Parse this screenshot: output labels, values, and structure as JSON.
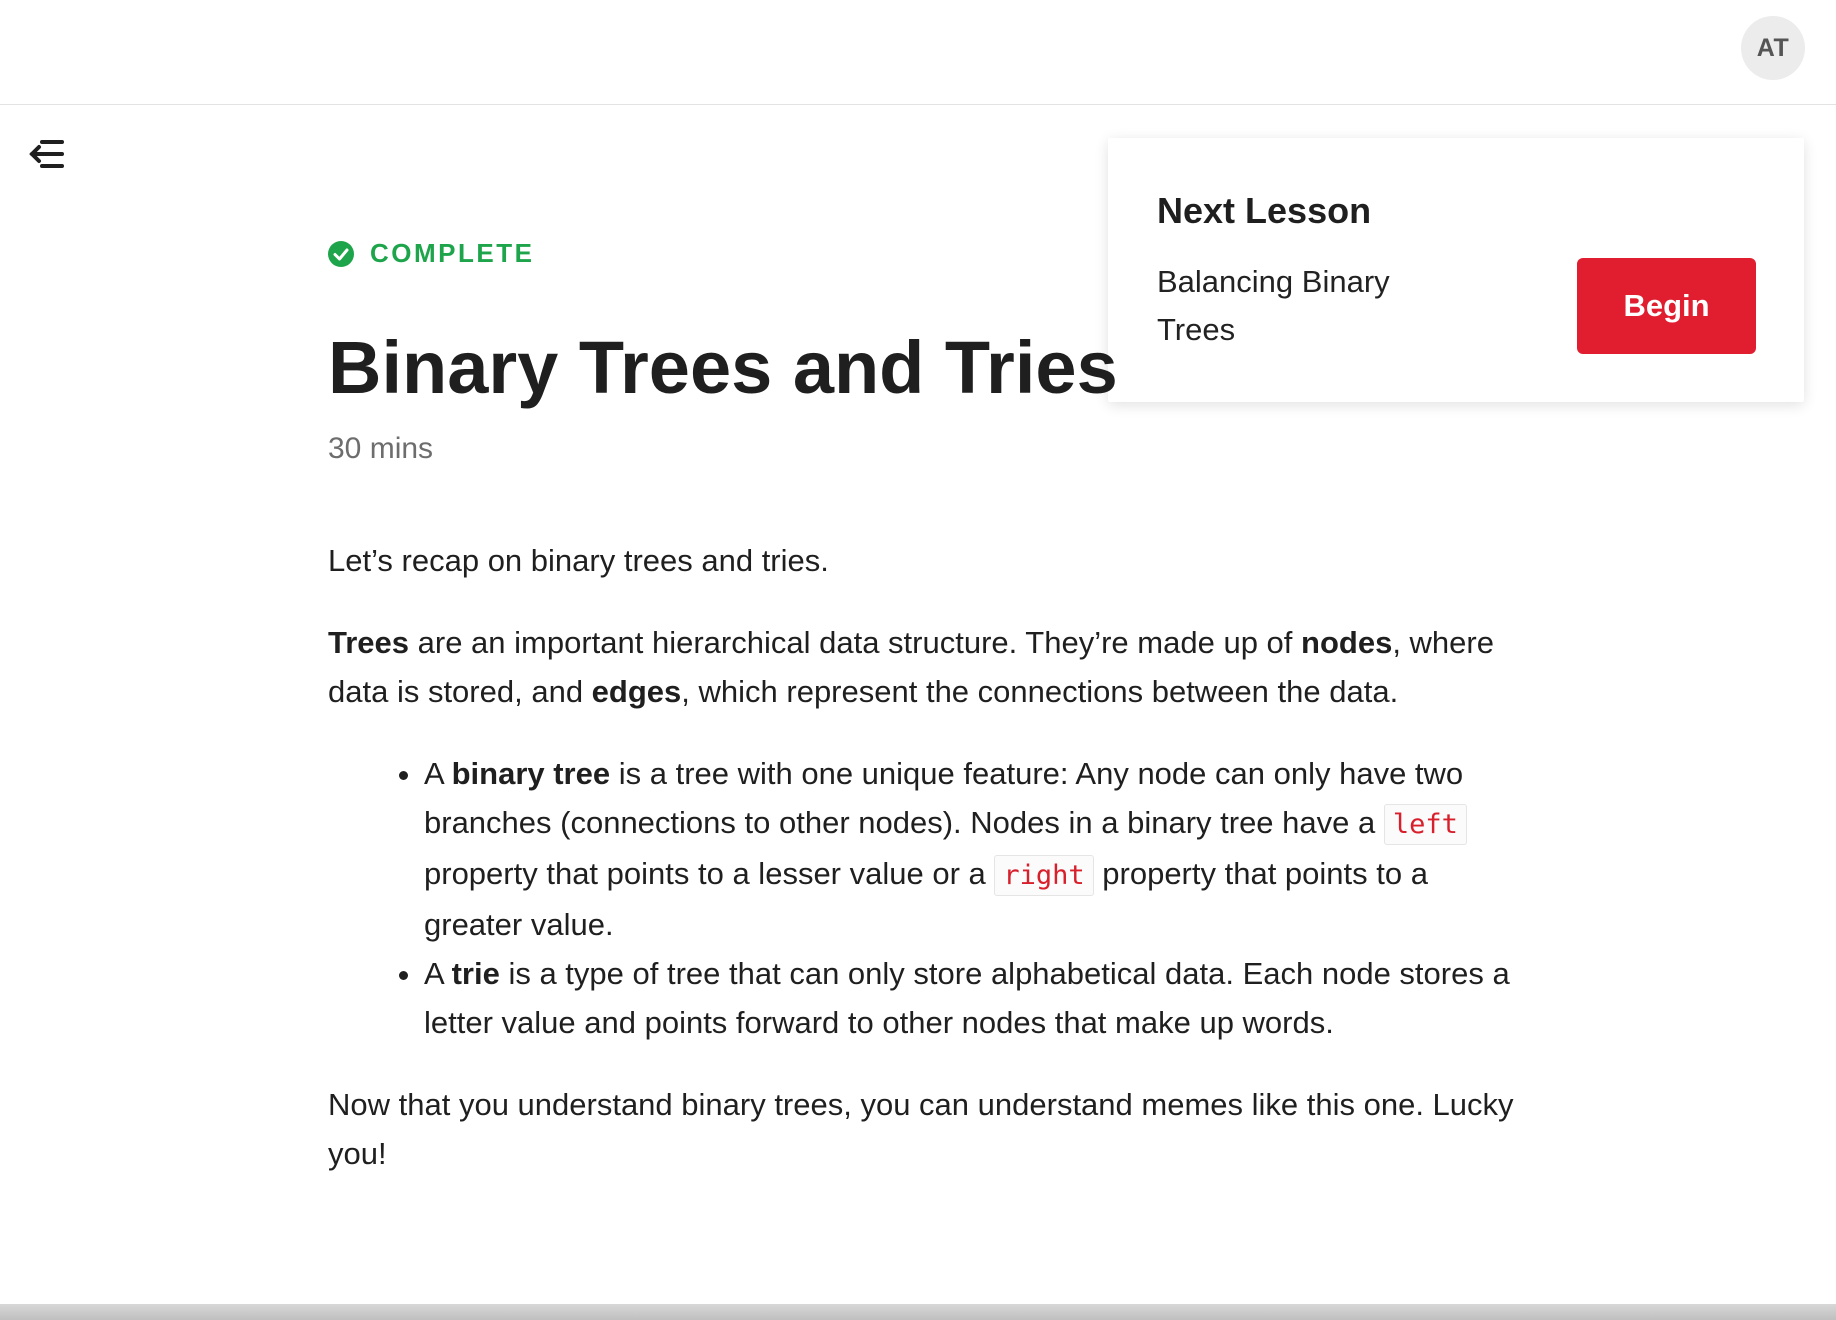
{
  "header": {
    "avatar_initials": "AT"
  },
  "sidebar_toggle": {
    "icon": "collapse-menu-icon"
  },
  "next_lesson": {
    "heading": "Next Lesson",
    "name": "Balancing Binary Trees",
    "button_label": "Begin",
    "button_color": "#e01e30"
  },
  "lesson": {
    "status": "COMPLETE",
    "status_color": "#1ea54c",
    "title": "Binary Trees and Tries",
    "duration": "30 mins"
  },
  "body": {
    "intro": "Let’s recap on binary trees and tries.",
    "p1": {
      "trees": "Trees",
      "t1": " are an important hierarchical data structure. They’re made up of ",
      "nodes": "nodes",
      "t2": ", where data is stored, and ",
      "edges": "edges",
      "t3": ", which represent the connections between the data."
    },
    "bullet1": {
      "a": "A ",
      "term": "binary tree",
      "t1": " is a tree with one unique feature: Any node can only have two branches (connections to other nodes). Nodes in a binary tree have a ",
      "code_left": "left",
      "t2": " property that points to a lesser value or a ",
      "code_right": "right",
      "t3": " property that points to a greater value."
    },
    "bullet2": {
      "a": "A ",
      "term": "trie",
      "t1": " is a type of tree that can only store alphabetical data. Each node stores a letter value and points forward to other nodes that make up words."
    },
    "closing": "Now that you understand binary trees, you can understand memes like this one. Lucky you!"
  }
}
